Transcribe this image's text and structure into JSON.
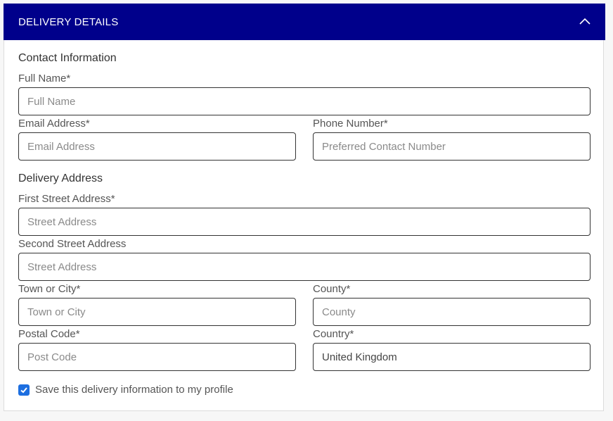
{
  "header": {
    "title": "DELIVERY DETAILS",
    "toggle_icon": "chevron-up-icon",
    "background": "#00008b"
  },
  "contact": {
    "section_title": "Contact Information",
    "full_name": {
      "label": "Full Name*",
      "placeholder": "Full Name"
    },
    "email": {
      "label": "Email Address*",
      "placeholder": "Email Address"
    },
    "phone": {
      "label": "Phone Number*",
      "placeholder": "Preferred Contact Number"
    }
  },
  "address": {
    "section_title": "Delivery Address",
    "street1": {
      "label": "First Street Address*",
      "placeholder": "Street Address"
    },
    "street2": {
      "label": "Second Street Address",
      "placeholder": "Street Address"
    },
    "town": {
      "label": "Town or City*",
      "placeholder": "Town or City"
    },
    "county": {
      "label": "County*",
      "placeholder": "County"
    },
    "postal": {
      "label": "Postal Code*",
      "placeholder": "Post Code"
    },
    "country": {
      "label": "Country*",
      "value": "United Kingdom"
    }
  },
  "save_profile": {
    "label": "Save this delivery information to my profile",
    "checked": true,
    "color": "#1d6fe0"
  }
}
